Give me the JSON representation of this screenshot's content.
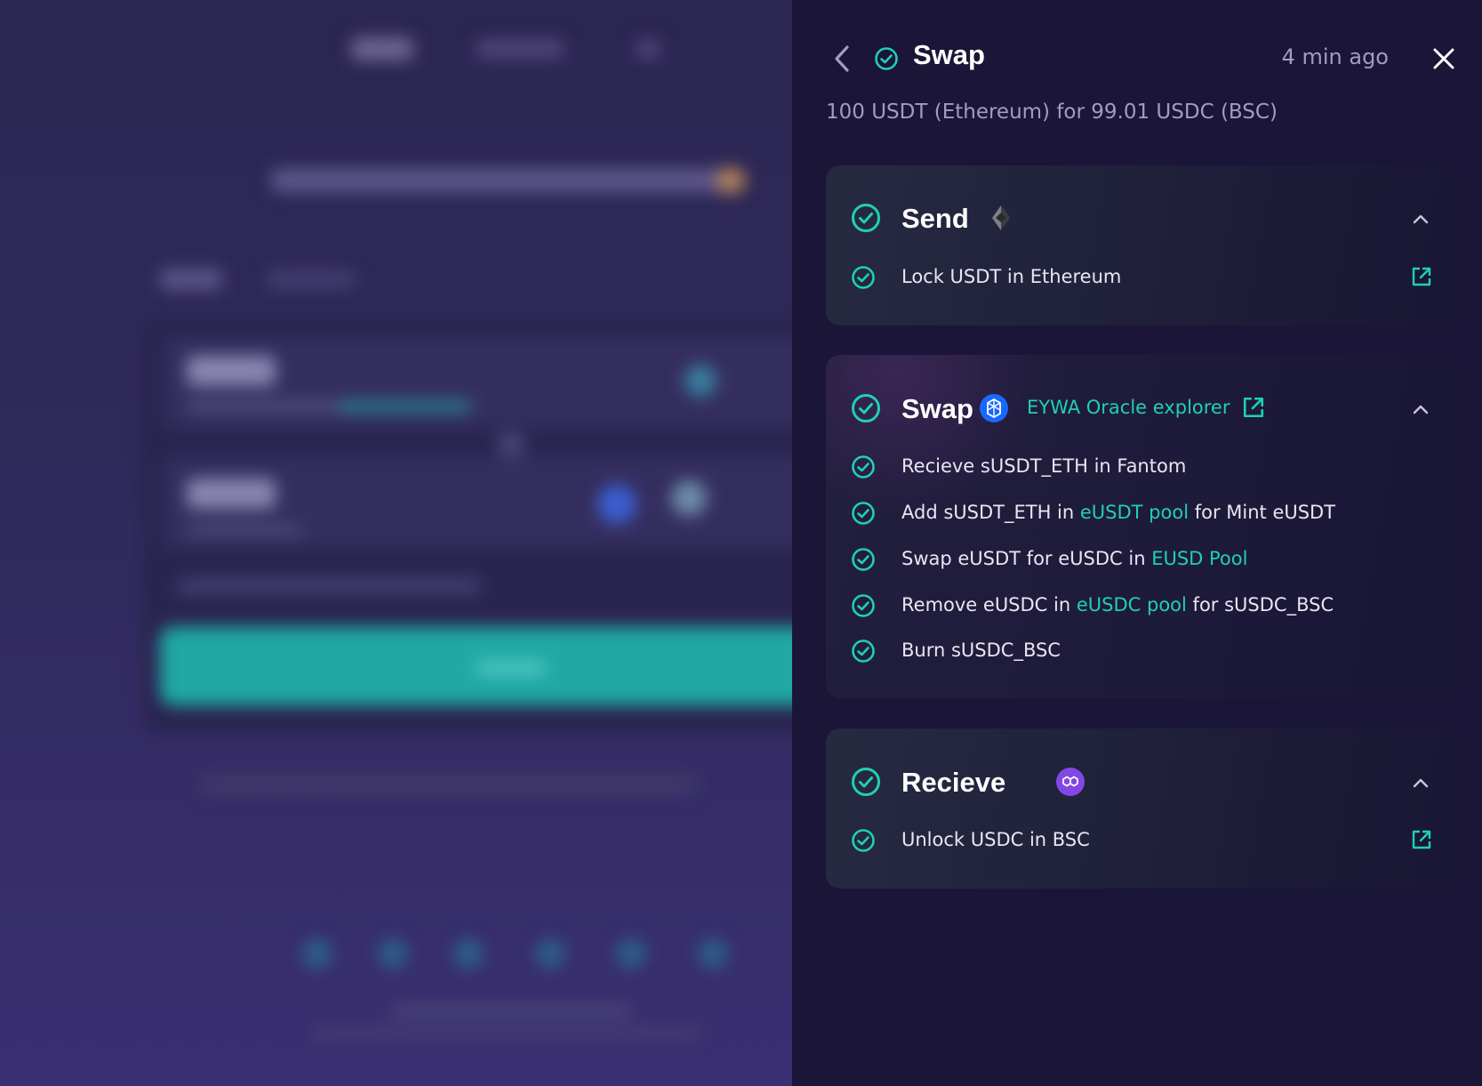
{
  "header": {
    "title": "Swap",
    "time": "4 min ago",
    "summary": "100 USDT (Ethereum) for 99.01 USDC (BSC)"
  },
  "sections": {
    "send": {
      "title": "Send",
      "chain_icon": "ethereum-icon",
      "steps": [
        "Lock USDT in Ethereum"
      ]
    },
    "swap": {
      "title": "Swap",
      "chain_icon": "fantom-icon",
      "oracle_link": "EYWA Oracle explorer",
      "steps": {
        "s1": {
          "text": "Recieve sUSDT_ETH in Fantom"
        },
        "s2": {
          "pre": "Add sUSDT_ETH in",
          "link": "eUSDT pool",
          "post": "for Mint eUSDT"
        },
        "s3": {
          "pre": "Swap eUSDT for eUSDC in",
          "link": "EUSD Pool"
        },
        "s4": {
          "pre": "Remove eUSDC in",
          "link": "eUSDC pool",
          "post": "for sUSDC_BSC"
        },
        "s5": {
          "text": "Burn sUSDC_BSC"
        }
      }
    },
    "recieve": {
      "title": "Recieve",
      "chain_icon": "polygon-icon",
      "steps": [
        "Unlock USDC in BSC"
      ]
    }
  },
  "colors": {
    "accent": "#1fd0b4",
    "panel_bg": "#1b1537",
    "muted_text": "#a29bc4",
    "fantom_blue": "#1969ff",
    "polygon_purple": "#8247e5"
  }
}
